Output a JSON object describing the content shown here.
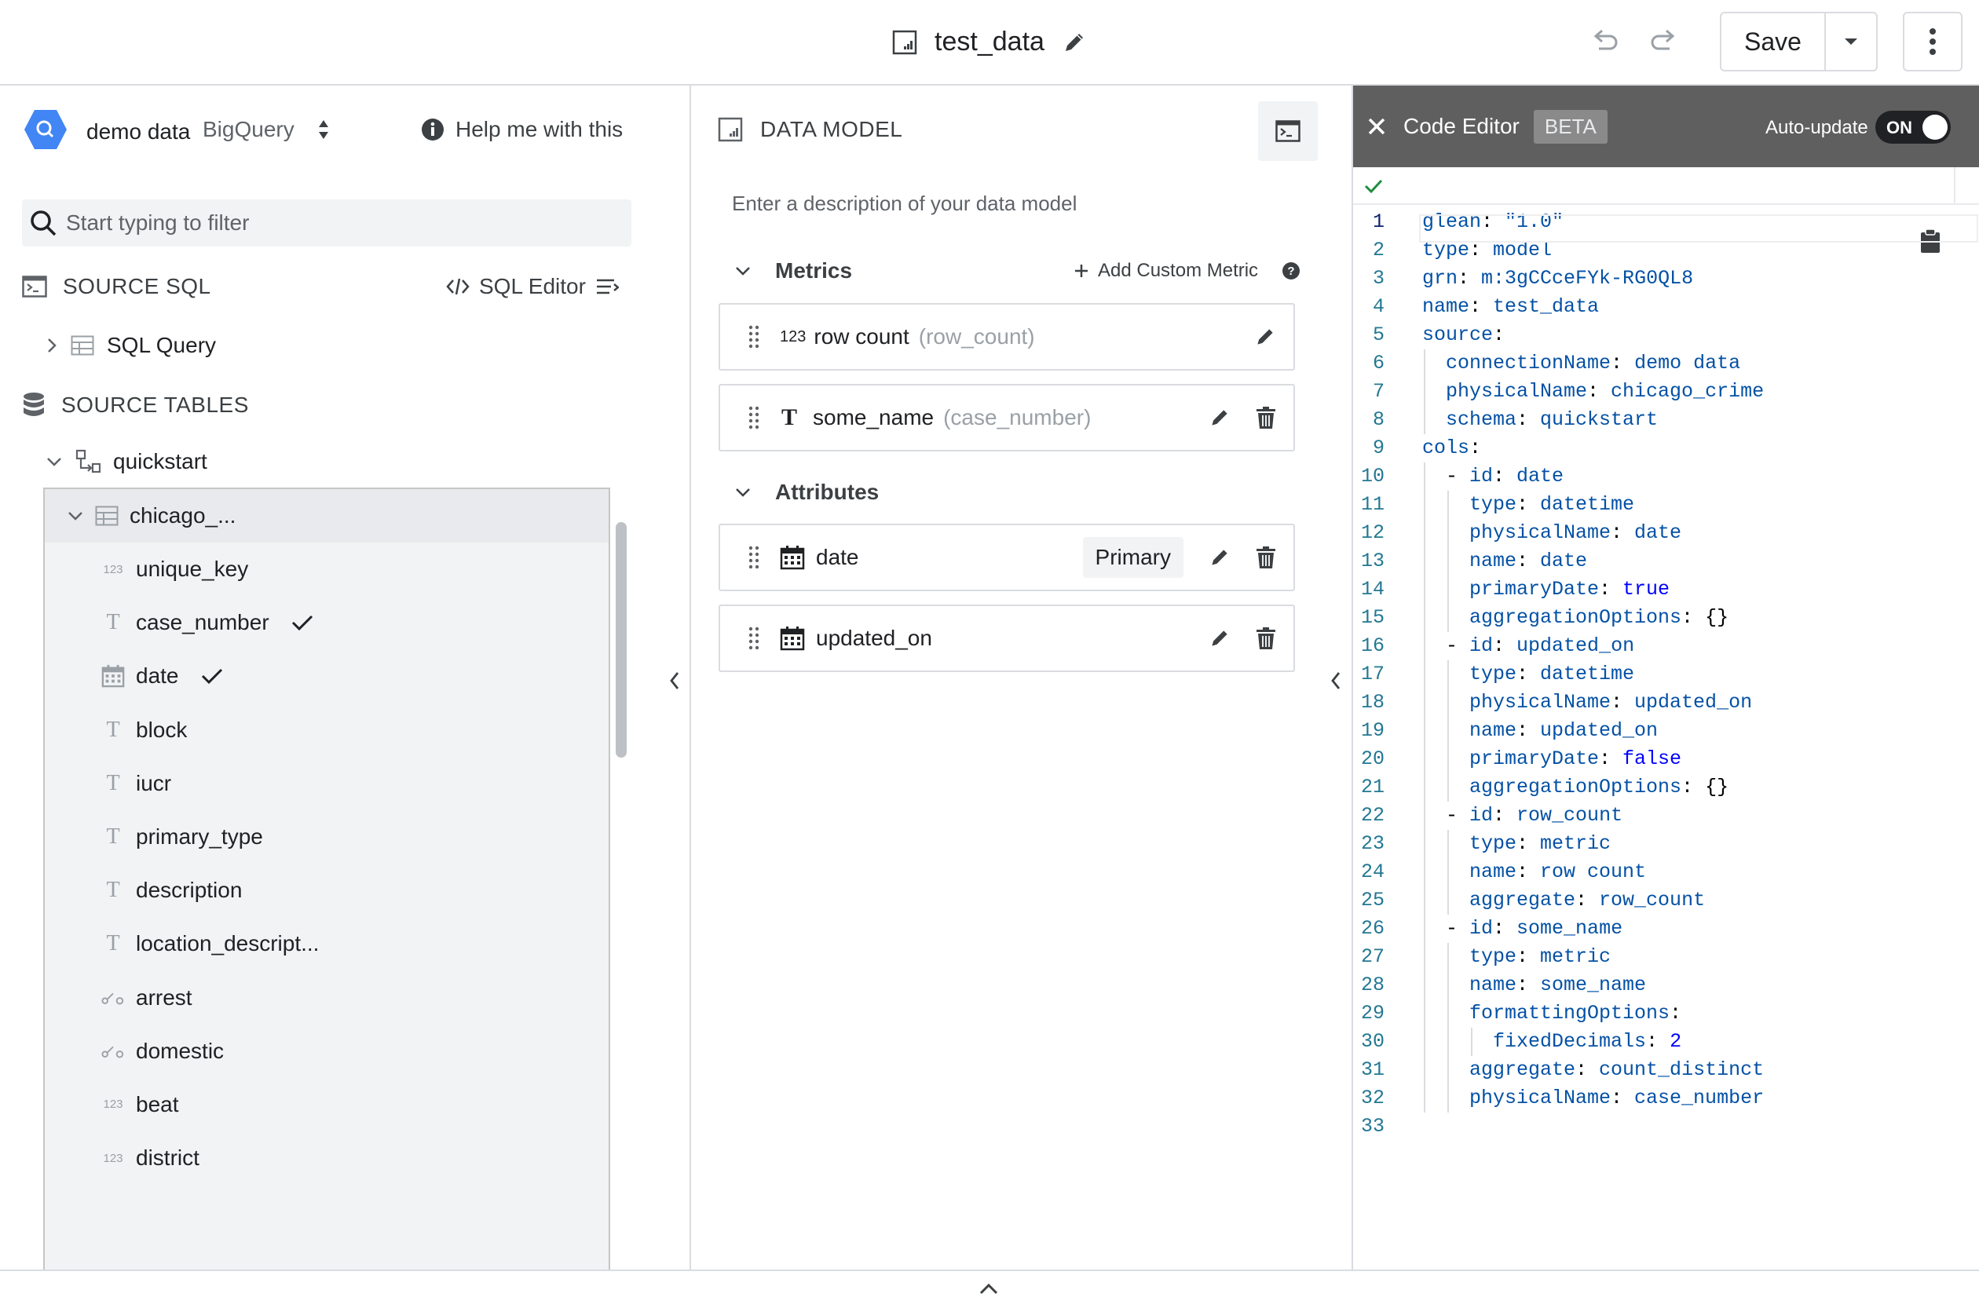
{
  "header": {
    "title": "test_data",
    "save_label": "Save"
  },
  "left": {
    "connection_name": "demo data",
    "connection_type": "BigQuery",
    "help_label": "Help me with this",
    "filter_placeholder": "Start typing to filter",
    "source_sql_label": "SOURCE SQL",
    "sql_editor_label": "SQL Editor",
    "sql_query_label": "SQL Query",
    "source_tables_label": "SOURCE TABLES",
    "schema_name": "quickstart",
    "table_name": "chicago_...",
    "fields": [
      {
        "type": "num",
        "type_label": "123",
        "name": "unique_key",
        "checked": false
      },
      {
        "type": "text",
        "type_label": "T",
        "name": "case_number",
        "checked": true
      },
      {
        "type": "date",
        "type_label": "",
        "name": "date",
        "checked": true
      },
      {
        "type": "text",
        "type_label": "T",
        "name": "block",
        "checked": false
      },
      {
        "type": "text",
        "type_label": "T",
        "name": "iucr",
        "checked": false
      },
      {
        "type": "text",
        "type_label": "T",
        "name": "primary_type",
        "checked": false
      },
      {
        "type": "text",
        "type_label": "T",
        "name": "description",
        "checked": false
      },
      {
        "type": "text",
        "type_label": "T",
        "name": "location_descript...",
        "checked": false
      },
      {
        "type": "bool",
        "type_label": "",
        "name": "arrest",
        "checked": false
      },
      {
        "type": "bool",
        "type_label": "",
        "name": "domestic",
        "checked": false
      },
      {
        "type": "num",
        "type_label": "123",
        "name": "beat",
        "checked": false
      },
      {
        "type": "num",
        "type_label": "123",
        "name": "district",
        "checked": false
      }
    ]
  },
  "middle": {
    "title": "DATA MODEL",
    "description_placeholder": "Enter a description of your data model",
    "metrics_label": "Metrics",
    "add_metric_label": "Add Custom Metric",
    "metrics": [
      {
        "icon_label": "123",
        "label": "row count",
        "sub": "(row_count)"
      },
      {
        "icon_label": "T",
        "label": "some_name",
        "sub": "(case_number)"
      }
    ],
    "attributes_label": "Attributes",
    "attributes": [
      {
        "label": "date",
        "chip": "Primary"
      },
      {
        "label": "updated_on",
        "chip": ""
      }
    ]
  },
  "code_editor": {
    "title": "Code Editor",
    "beta_label": "BETA",
    "auto_update_label": "Auto-update",
    "toggle_state": "ON",
    "lines": [
      {
        "n": "1",
        "indent": 0,
        "key": "glean",
        "val": "\"1.0\"",
        "vc": "s"
      },
      {
        "n": "2",
        "indent": 0,
        "key": "type",
        "val": "model",
        "vc": "v"
      },
      {
        "n": "3",
        "indent": 0,
        "key": "grn",
        "val": "m:3gCCceFYk-RG0QL8",
        "vc": "v"
      },
      {
        "n": "4",
        "indent": 0,
        "key": "name",
        "val": "test_data",
        "vc": "v"
      },
      {
        "n": "5",
        "indent": 0,
        "key": "source",
        "val": "",
        "vc": "v"
      },
      {
        "n": "6",
        "indent": 1,
        "key": "connectionName",
        "val": "demo data",
        "vc": "v"
      },
      {
        "n": "7",
        "indent": 1,
        "key": "physicalName",
        "val": "chicago_crime",
        "vc": "v"
      },
      {
        "n": "8",
        "indent": 1,
        "key": "schema",
        "val": "quickstart",
        "vc": "v"
      },
      {
        "n": "9",
        "indent": 0,
        "key": "cols",
        "val": "",
        "vc": "v"
      },
      {
        "n": "10",
        "indent": 1,
        "dash": true,
        "key": "id",
        "val": "date",
        "vc": "v"
      },
      {
        "n": "11",
        "indent": 2,
        "key": "type",
        "val": "datetime",
        "vc": "v"
      },
      {
        "n": "12",
        "indent": 2,
        "key": "physicalName",
        "val": "date",
        "vc": "v"
      },
      {
        "n": "13",
        "indent": 2,
        "key": "name",
        "val": "date",
        "vc": "v"
      },
      {
        "n": "14",
        "indent": 2,
        "key": "primaryDate",
        "val": "true",
        "vc": "b"
      },
      {
        "n": "15",
        "indent": 2,
        "key": "aggregationOptions",
        "val": "{}",
        "vc": "p"
      },
      {
        "n": "16",
        "indent": 1,
        "dash": true,
        "key": "id",
        "val": "updated_on",
        "vc": "v"
      },
      {
        "n": "17",
        "indent": 2,
        "key": "type",
        "val": "datetime",
        "vc": "v"
      },
      {
        "n": "18",
        "indent": 2,
        "key": "physicalName",
        "val": "updated_on",
        "vc": "v"
      },
      {
        "n": "19",
        "indent": 2,
        "key": "name",
        "val": "updated_on",
        "vc": "v"
      },
      {
        "n": "20",
        "indent": 2,
        "key": "primaryDate",
        "val": "false",
        "vc": "b"
      },
      {
        "n": "21",
        "indent": 2,
        "key": "aggregationOptions",
        "val": "{}",
        "vc": "p"
      },
      {
        "n": "22",
        "indent": 1,
        "dash": true,
        "key": "id",
        "val": "row_count",
        "vc": "v"
      },
      {
        "n": "23",
        "indent": 2,
        "key": "type",
        "val": "metric",
        "vc": "v"
      },
      {
        "n": "24",
        "indent": 2,
        "key": "name",
        "val": "row count",
        "vc": "v"
      },
      {
        "n": "25",
        "indent": 2,
        "key": "aggregate",
        "val": "row_count",
        "vc": "v"
      },
      {
        "n": "26",
        "indent": 1,
        "dash": true,
        "key": "id",
        "val": "some_name",
        "vc": "v"
      },
      {
        "n": "27",
        "indent": 2,
        "key": "type",
        "val": "metric",
        "vc": "v"
      },
      {
        "n": "28",
        "indent": 2,
        "key": "name",
        "val": "some_name",
        "vc": "v"
      },
      {
        "n": "29",
        "indent": 2,
        "key": "formattingOptions",
        "val": "",
        "vc": "v"
      },
      {
        "n": "30",
        "indent": 3,
        "key": "fixedDecimals",
        "val": "2",
        "vc": "b"
      },
      {
        "n": "31",
        "indent": 2,
        "key": "aggregate",
        "val": "count_distinct",
        "vc": "v"
      },
      {
        "n": "32",
        "indent": 2,
        "key": "physicalName",
        "val": "case_number",
        "vc": "v"
      },
      {
        "n": "33",
        "indent": 0,
        "key": "",
        "val": "",
        "vc": "v"
      }
    ]
  },
  "colors": {
    "border": "#dadce0",
    "code_header_bg": "#5f5f5f",
    "connection_icon": "#4285f4",
    "line_number": "#237893",
    "success_check": "#1e8e3e"
  },
  "icons": [
    "report-icon",
    "pencil-icon",
    "undo-icon",
    "redo-icon",
    "caret-down-icon",
    "kebab-icon",
    "bigquery-icon",
    "sort-arrows-icon",
    "info-icon",
    "search-icon",
    "terminal-icon",
    "code-icon",
    "wrap-icon",
    "chevron-right-icon",
    "table-icon",
    "database-icon",
    "chevron-down-icon",
    "schema-icon",
    "check-icon",
    "calendar-icon",
    "boolean-icon",
    "drag-handle-icon",
    "trash-icon",
    "plus-icon",
    "help-icon",
    "close-icon",
    "clipboard-icon",
    "chevron-left-icon",
    "chevron-up-icon"
  ]
}
